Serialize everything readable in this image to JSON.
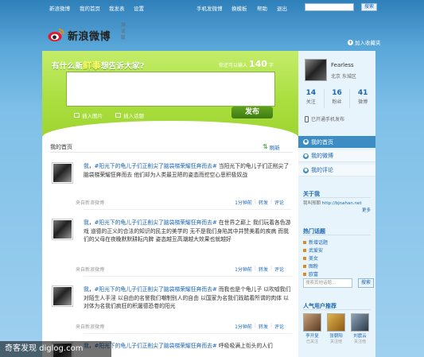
{
  "topnav": {
    "items": [
      "新浪微博",
      "我的首页",
      "我发表",
      "设置",
      "手机发微博",
      "换模板",
      "帮助",
      "退出"
    ],
    "search_button": "搜索"
  },
  "brand": {
    "name": "新浪微博",
    "beta": "测试版",
    "follow": "加入收藏夹"
  },
  "publisher": {
    "slogan_pre": "有什么新",
    "slogan_hl": "鲜事",
    "slogan_post": "想告诉大家?",
    "counter_pre": "你还可以输入",
    "counter_num": "140",
    "counter_post": "字",
    "tools": [
      "插入图片",
      "插入话题"
    ],
    "post_button": "发布"
  },
  "feed_header": {
    "title": "我的首页",
    "refresh": "刷新"
  },
  "feed": [
    {
      "author": "我",
      "repost": "#阳光下的龟儿子们正削尖了脑袋梯荣耀狂奔而去#",
      "text": " 当阳光下的龟儿子们正削尖了脑袋梯荣耀狂奔而去 他们却为人类最丑陋的姿态而挖空心思积极奴战",
      "source": "来自新浪微博",
      "actions": [
        "1分钟前",
        "转发",
        "评论"
      ]
    },
    {
      "author": "我",
      "repost": "#阳光下的龟儿子们正削尖了脑袋梯荣耀狂奔而去#",
      "text": " 在世界之巅上 我们玩着各色游戏 道德的正义的合法的知识的民主的美学的 无不是我们身陷其中并赞美着的疾病 而我们的父母在夜晚默默耕耘内脾 姿态越丑高潮越大效果也就越好",
      "source": "来自新浪微博",
      "actions": [
        "1分钟前",
        "转发",
        "评论"
      ]
    },
    {
      "author": "我",
      "repost": "#阳光下的龟儿子们正削尖了脑袋梯荣耀狂奔而去#",
      "text": " 而我也是个龟儿子 以吹嘘我们对陌生人手淫 以自由的名誉我们嘲制别人的自由 以国家为名我们践踏着所谓的肉体 以对体为名我们疯狂的积屠德恐卷的阳光",
      "source": "来自新浪微博",
      "actions": [
        "1分钟前",
        "转发",
        "评论"
      ]
    },
    {
      "author": "我",
      "repost": "#阳光下的龟儿子们正削尖了脑袋梯荣耀狂奔而去#",
      "text": " 呼吸吸满上衔头的人们",
      "source": "",
      "actions": []
    }
  ],
  "profile": {
    "name": "Fearless",
    "location": "北京 东城区",
    "stats": [
      {
        "n": "14",
        "l": "关注"
      },
      {
        "n": "16",
        "l": "粉丝"
      },
      {
        "n": "41",
        "l": "微博"
      }
    ],
    "bind_phone": "已开通手机发布"
  },
  "side_nav": [
    "我的首页",
    "我的微博",
    "我的评论"
  ],
  "about": {
    "title": "关于我",
    "text_pre": "我叫邢朝 ",
    "link": "http://bjnahan.net",
    "more": "更多"
  },
  "topics": {
    "title": "热门话题",
    "items": [
      "新增话题",
      "武爱安",
      "美女",
      "图粉",
      "欧富"
    ],
    "input_placeholder": "搜索其他话题...",
    "search_button": "搜索"
  },
  "recommend": {
    "title": "人气用户推荐",
    "users": [
      {
        "name": "李开复",
        "follow": "已关注"
      },
      {
        "name": "张朝阳",
        "follow": "关注他"
      },
      {
        "name": "刘震云",
        "follow": "关注他"
      }
    ]
  },
  "watermark": "奇客发现 diglog.com"
}
